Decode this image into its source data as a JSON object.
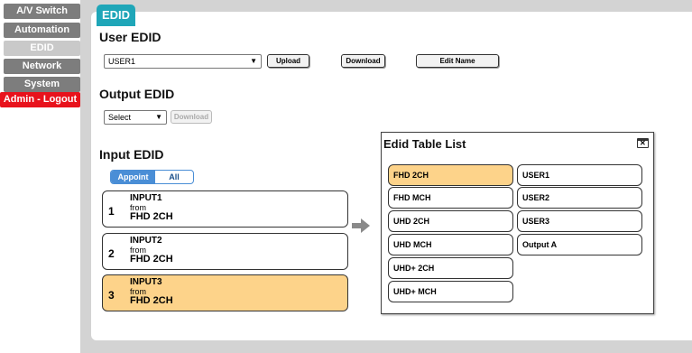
{
  "sidebar": {
    "items": [
      {
        "label": "A/V Switch"
      },
      {
        "label": "Automation"
      },
      {
        "label": "EDID"
      },
      {
        "label": "Network"
      },
      {
        "label": "System"
      },
      {
        "label": "Admin - Logout"
      }
    ]
  },
  "tab": {
    "label": "EDID"
  },
  "user_edid": {
    "title": "User EDID",
    "select_value": "USER1",
    "upload_label": "Upload",
    "download_label": "Download",
    "edit_name_label": "Edit Name"
  },
  "output_edid": {
    "title": "Output EDID",
    "select_value": "Select",
    "download_label": "Download"
  },
  "input_edid": {
    "title": "Input EDID",
    "toggle": {
      "appoint": "Appoint",
      "all": "All"
    },
    "inputs": [
      {
        "num": "1",
        "name": "INPUT1",
        "from": "from",
        "edid": "FHD 2CH"
      },
      {
        "num": "2",
        "name": "INPUT2",
        "from": "from",
        "edid": "FHD 2CH"
      },
      {
        "num": "3",
        "name": "INPUT3",
        "from": "from",
        "edid": "FHD 2CH"
      }
    ]
  },
  "edid_table": {
    "title": "Edid Table List",
    "left": [
      "FHD 2CH",
      "FHD MCH",
      "UHD 2CH",
      "UHD MCH",
      "UHD+ 2CH",
      "UHD+ MCH"
    ],
    "right": [
      "USER1",
      "USER2",
      "USER3",
      "Output A"
    ]
  },
  "colors": {
    "accent": "#1fa6b8",
    "selected": "#fdd38a",
    "logout": "#e8121c"
  }
}
